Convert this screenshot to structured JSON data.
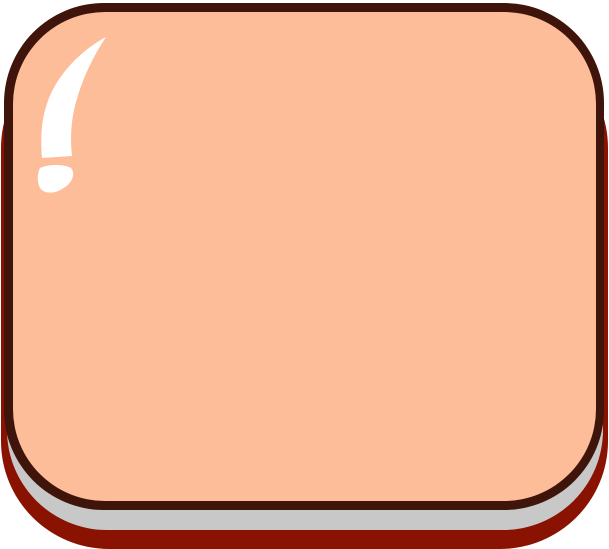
{
  "button": {
    "label": "",
    "colors": {
      "face": "#FDBD98",
      "outline": "#3F140B",
      "bevel": "#C8C8C8",
      "base": "#8A1200",
      "highlight": "#FFFFFF"
    }
  }
}
